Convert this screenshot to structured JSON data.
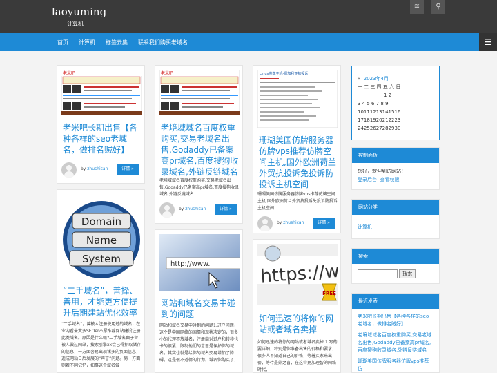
{
  "site": {
    "title": "laoyuming",
    "description": "计算机"
  },
  "nav": {
    "items": [
      "首页",
      "计算机",
      "标签云集",
      "联系我们购买老域名"
    ]
  },
  "posts": [
    {
      "title": "老米吧长期出售【各种各样的seo老域名，做排名贼好】",
      "excerpt": "",
      "author": "zhushican",
      "more": "详情 »"
    },
    {
      "title": "老境域域名百度权重购买,交易老域名出售,Godaddy已备案高pr域名,百度搜狗收录域名,外链反链域名",
      "excerpt": "老境域域名百度权重购买,交易老域名出售,Godaddy已备案高pr域名,百度搜狗收录域名,外链反链域名",
      "author": "zhushican",
      "more": "详情 »"
    },
    {
      "title": "珊瑚美国仿牌服务器仿牌vps推荐仿牌空间主机,国外欧洲荷兰外贸抗投诉免投诉防投诉主机空间",
      "excerpt": "珊瑚美国仿牌服务器仿牌vps推荐仿牌空间主机,国外欧洲荷兰外贸抗投诉免投诉防投诉主机空间",
      "author": "zhushican",
      "more": "详情 »"
    },
    {
      "title": "“二手域名”，善择、善用，才能更方便提升后期建站优化效率",
      "excerpt": "“二手域名”，曾被人注册使用过的域名，在业内看来大多SEOer不愿推荐网站建设注册此类域名。原因是什么呢?二手域名由于曾被人做过网站，搜索引擎xx会已得抓取储存的信息，一方面容易出现诸多的负面信息，造成网站日后发展的“声誉”问题。另一方面则若不同记忆，如事这个域名做"
    },
    {
      "title": "网站和域名交易中碰到的问题",
      "excerpt": "网站和域名交易中碰到的问题1.过户问题，这个是中国网络的国情和现状决定的，很多小的代理不放域名，注册商对过户和转移也卡的很紧，限制他们的意思是保护你的域名，其实也就是给你的域名交易增加了障碍，这是很不道德的行为。域名你购买了，"
    },
    {
      "title": "如何迅速的将你的网站或者域名卖掉",
      "excerpt": "如何迅速的将你的网站或者域名卖掉 1.写的要详细，特别是你准备出售的价格和要求，很多人不知道自己的价格，等着买家来出价，等待是外之喜，在这个更加理智的网络时代，"
    }
  ],
  "thumb_texts": {
    "banner": "老米吧",
    "sign": [
      "Domain",
      "Name",
      "System"
    ],
    "http": "http://www.",
    "https": "https://www",
    "free": "FREE",
    "ad": "Linux共享主机-保加利亚抗投诉"
  },
  "sidebar": {
    "calendar": {
      "nav_prev": "«",
      "month": "2023年4月",
      "nav_next": "»",
      "weekdays": "一 二 三 四 五 六 日",
      "rows": [
        "1 2",
        "3 4 5 6 7 8 9",
        "10111213141516",
        "17181920212223",
        "24252627282930"
      ]
    },
    "control_panel": {
      "title": "控制面板",
      "welcome": "您好，欢迎到访网站！",
      "links": [
        "登录后台",
        "查看权限"
      ]
    },
    "categories": {
      "title": "网站分类",
      "items": [
        "计算机"
      ]
    },
    "search": {
      "title": "搜索",
      "button": "搜索"
    },
    "recent": {
      "title": "最近发表",
      "items": [
        "老米吧长期出售【各种各样的seo老域名，做排名贼好】",
        "老境域域名百度权重购买,交易老域名出售,Godaddy已备案高pr域名,百度搜狗收录域名,外链反链域名",
        "珊瑚美国仿牌服务器仿牌vps推荐仿"
      ]
    }
  },
  "colors": {
    "accent": "#1e8ad6",
    "topbar": "#3a3a3a",
    "background": "#f3f3f3"
  },
  "icons": [
    "rss-icon",
    "search-icon",
    "menu-icon"
  ]
}
